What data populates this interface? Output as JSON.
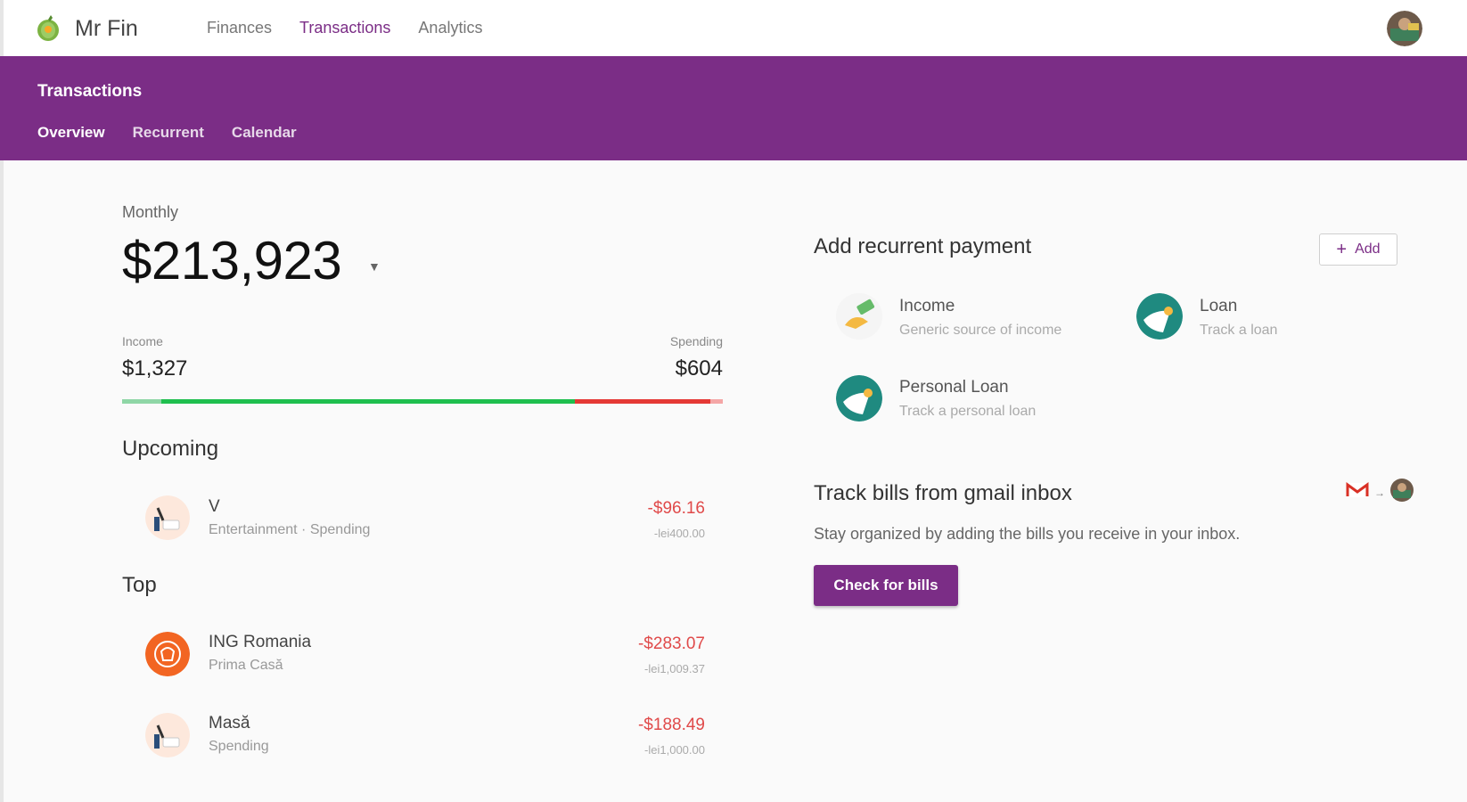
{
  "app": {
    "title": "Mr Fin"
  },
  "nav": {
    "items": [
      "Finances",
      "Transactions",
      "Analytics"
    ],
    "active": "Transactions"
  },
  "banner": {
    "title": "Transactions",
    "subtabs": [
      "Overview",
      "Recurrent",
      "Calendar"
    ],
    "active": "Overview"
  },
  "summary": {
    "period_label": "Monthly",
    "total": "$213,923",
    "income_label": "Income",
    "income_value": "$1,327",
    "spending_label": "Spending",
    "spending_value": "$604",
    "bar_segments": [
      {
        "fraction": 0.066,
        "color": "#8fd6a6"
      },
      {
        "fraction": 0.688,
        "color": "#1fbf4e"
      },
      {
        "fraction": 0.226,
        "color": "#e53935"
      },
      {
        "fraction": 0.02,
        "color": "#f4a6a6"
      }
    ]
  },
  "upcoming": {
    "heading": "Upcoming",
    "items": [
      {
        "name": "V",
        "category": "Entertainment · Spending",
        "amount": "-$96.16",
        "original": "-lei400.00",
        "icon": "cart-icon"
      }
    ]
  },
  "top": {
    "heading": "Top",
    "items": [
      {
        "name": "ING Romania",
        "category": "Prima Casă",
        "amount": "-$283.07",
        "original": "-lei1,009.37",
        "icon": "ing-logo-icon"
      },
      {
        "name": "Masă",
        "category": "Spending",
        "amount": "-$188.49",
        "original": "-lei1,000.00",
        "icon": "cart-icon"
      }
    ]
  },
  "recurrent": {
    "title": "Add recurrent payment",
    "add_label": "Add",
    "options": [
      {
        "name": "Income",
        "desc": "Generic source of income",
        "icon": "money-hand-icon"
      },
      {
        "name": "Loan",
        "desc": "Track a loan",
        "icon": "loan-icon"
      },
      {
        "name": "Personal Loan",
        "desc": "Track a personal loan",
        "icon": "personal-loan-icon"
      }
    ]
  },
  "track_bills": {
    "title": "Track bills from gmail inbox",
    "description": "Stay organized by adding the bills you receive in your inbox.",
    "button_label": "Check for bills"
  },
  "colors": {
    "brand": "#7b2d86",
    "negative": "#e04a4a"
  }
}
